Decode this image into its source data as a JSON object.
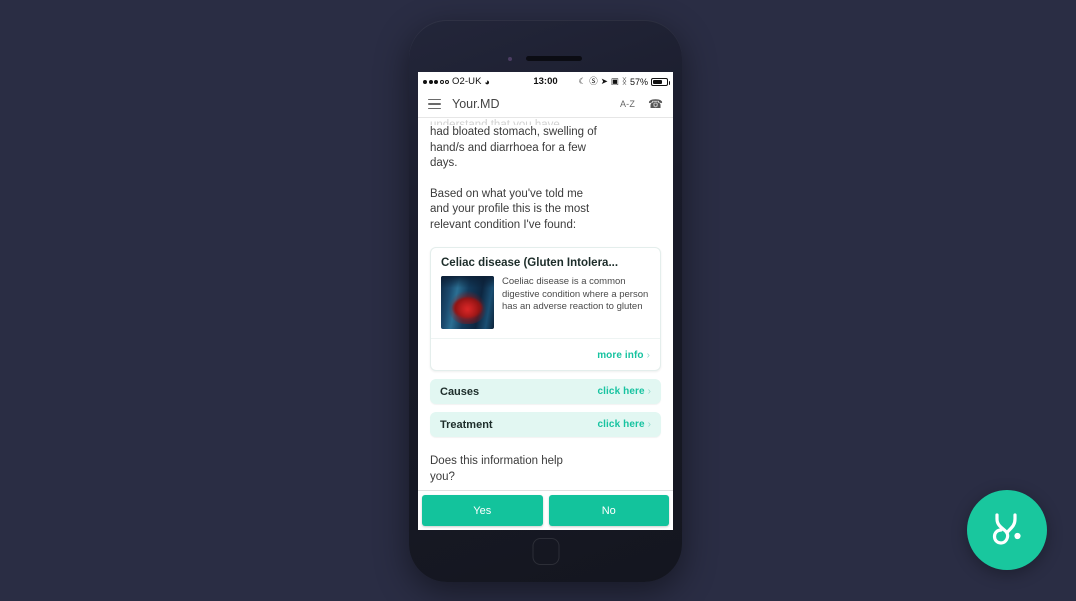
{
  "background_color": "#2a2d44",
  "accent_color": "#13c39c",
  "statusbar": {
    "carrier": "O2-UK",
    "wifi_icon": "wifi-icon",
    "time": "13:00",
    "moon_icon": "moon-icon",
    "rotation_lock_icon": "rotation-lock-icon",
    "location_icon": "location-arrow-icon",
    "alarm_icon": "alarm-icon",
    "bluetooth_icon": "bluetooth-icon",
    "battery_percent": "57%",
    "battery_icon": "battery-icon"
  },
  "navbar": {
    "menu_icon": "hamburger-menu-icon",
    "title": "Your.MD",
    "az_label": "A-Z",
    "call_icon": "phone-icon"
  },
  "chat": {
    "clipped_line": "understand that you have",
    "message_1": "had bloated stomach, swelling of hand/s and diarrhoea for a few days.",
    "message_2": "Based on what you've told me and your profile this is the most relevant condition I've found:",
    "question": "Does this information help you?"
  },
  "condition_card": {
    "title": "Celiac disease (Gluten Intolera...",
    "image_icon": "intestine-illustration",
    "description": "Coeliac disease is a common digestive condition where a person has an adverse reaction to gluten",
    "more_info_label": "more info",
    "chevron_icon": "chevron-right-icon"
  },
  "actions": [
    {
      "label": "Causes",
      "link_label": "click here",
      "chevron_icon": "chevron-right-icon"
    },
    {
      "label": "Treatment",
      "link_label": "click here",
      "chevron_icon": "chevron-right-icon"
    }
  ],
  "answers": {
    "yes_label": "Yes",
    "no_label": "No"
  },
  "logo": {
    "icon": "stethoscope-logo-icon"
  }
}
